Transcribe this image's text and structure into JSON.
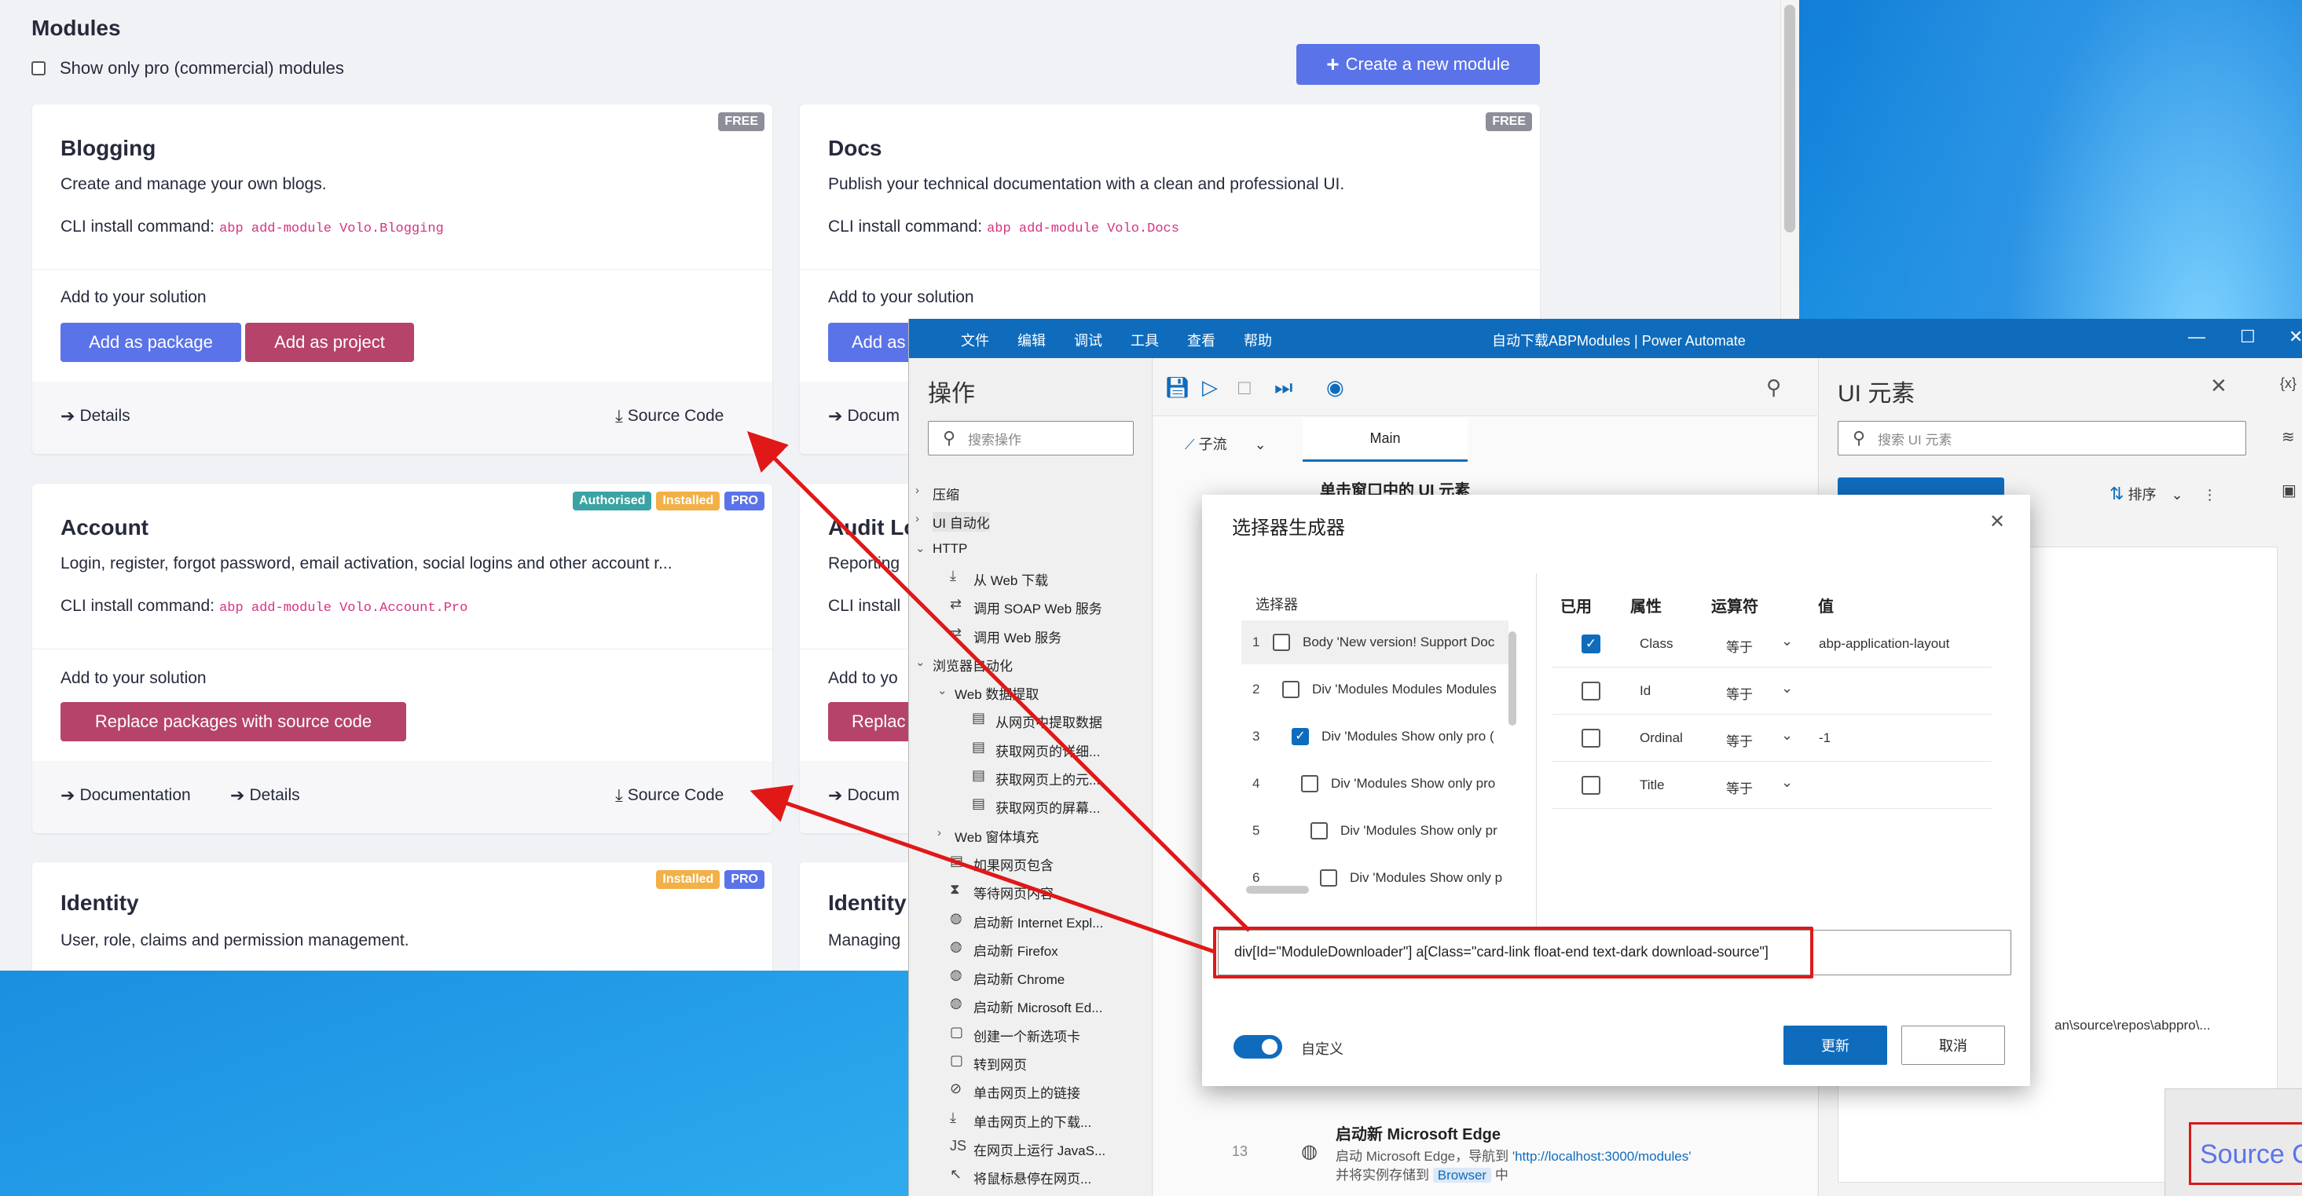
{
  "browser": {
    "page_title": "Modules",
    "pro_filter_label": "Show only pro (commercial) modules",
    "create_button": "Create a new module",
    "cards": [
      {
        "title": "Blogging",
        "badges": [
          "FREE"
        ],
        "description": "Create and manage your own blogs.",
        "cli_label": "CLI install command:",
        "cli_cmd": "abp add-module Volo.Blogging",
        "add_label": "Add to your solution",
        "btn_package": "Add as package",
        "btn_project": "Add as project",
        "details": "Details",
        "source_code": "Source Code"
      },
      {
        "title": "Docs",
        "badges": [
          "FREE"
        ],
        "description": "Publish your technical documentation with a clean and professional UI.",
        "cli_label": "CLI install command:",
        "cli_cmd": "abp add-module Volo.Docs",
        "add_label": "Add to your solution",
        "btn_package": "Add as",
        "documentation": "Docum"
      },
      {
        "title": "Account",
        "badges": [
          "Authorised",
          "Installed",
          "PRO"
        ],
        "description": "Login, register, forgot password, email activation, social logins and other account r...",
        "cli_label": "CLI install command:",
        "cli_cmd": "abp add-module Volo.Account.Pro",
        "add_label": "Add to your solution",
        "btn_replace": "Replace packages with source code",
        "documentation": "Documentation",
        "details": "Details",
        "source_code": "Source Code"
      },
      {
        "title": "Audit Lo",
        "description": "Reporting",
        "cli_label": "CLI install",
        "add_label": "Add to yo",
        "btn_replace": "Replac",
        "documentation": "Docum"
      },
      {
        "title": "Identity",
        "badges": [
          "Installed",
          "PRO"
        ],
        "description": "User, role, claims and permission management."
      },
      {
        "title": "Identity",
        "description": "Managing"
      }
    ]
  },
  "power_automate": {
    "window_title": "自动下载ABPModules | Power Automate",
    "menu": [
      "文件",
      "编辑",
      "调试",
      "工具",
      "查看",
      "帮助"
    ],
    "actions_title": "操作",
    "actions_search": "搜索操作",
    "tree": [
      {
        "label": "压缩",
        "level": 0,
        "arrow": "›"
      },
      {
        "label": "UI 自动化",
        "level": 0,
        "arrow": "›"
      },
      {
        "label": "HTTP",
        "level": 0,
        "arrow": "⌄"
      },
      {
        "label": "从 Web 下载",
        "level": 1,
        "icon": "⤓"
      },
      {
        "label": "调用 SOAP Web 服务",
        "level": 1,
        "icon": "⇄"
      },
      {
        "label": "调用 Web 服务",
        "level": 1,
        "icon": "⇄"
      },
      {
        "label": "浏览器自动化",
        "level": 0,
        "arrow": "⌄"
      },
      {
        "label": "Web 数据提取",
        "level": 1,
        "arrow": "⌄"
      },
      {
        "label": "从网页中提取数据",
        "level": 2,
        "icon": "▤"
      },
      {
        "label": "获取网页的详细...",
        "level": 2,
        "icon": "▤"
      },
      {
        "label": "获取网页上的元...",
        "level": 2,
        "icon": "▤"
      },
      {
        "label": "获取网页的屏幕...",
        "level": 2,
        "icon": "▤"
      },
      {
        "label": "Web 窗体填充",
        "level": 1,
        "arrow": "›"
      },
      {
        "label": "如果网页包含",
        "level": 1,
        "icon": "▤"
      },
      {
        "label": "等待网页内容",
        "level": 1,
        "icon": "⧗"
      },
      {
        "label": "启动新 Internet Expl...",
        "level": 1,
        "icon": "◍"
      },
      {
        "label": "启动新 Firefox",
        "level": 1,
        "icon": "◍"
      },
      {
        "label": "启动新 Chrome",
        "level": 1,
        "icon": "◍"
      },
      {
        "label": "启动新 Microsoft Ed...",
        "level": 1,
        "icon": "◍"
      },
      {
        "label": "创建一个新选项卡",
        "level": 1,
        "icon": "▢"
      },
      {
        "label": "转到网页",
        "level": 1,
        "icon": "▢"
      },
      {
        "label": "单击网页上的链接",
        "level": 1,
        "icon": "⊘"
      },
      {
        "label": "单击网页上的下载...",
        "level": 1,
        "icon": "⤓"
      },
      {
        "label": "在网页上运行 JavaS...",
        "level": 1,
        "icon": "JS"
      },
      {
        "label": "将鼠标悬停在网页...",
        "level": 1,
        "icon": "↖"
      }
    ],
    "subflow_label": "子流",
    "main_tab": "Main",
    "step_visible": {
      "num": "",
      "title": "单击窗口中的 UI 元素"
    },
    "step_13": {
      "num": "13",
      "title": "启动新 Microsoft Edge",
      "sub_prefix": "启动 Microsoft Edge，导航到 ",
      "sub_link": "'http://localhost:3000/modules'",
      "sub_prefix2": "并将实例存储到 ",
      "sub_var": "Browser",
      "sub_suffix": " 中"
    },
    "ui_title": "UI 元素",
    "ui_search": "搜索 UI 元素",
    "sort_label": "排序",
    "path_fragment": "an\\source\\repos\\abppro\\...",
    "thumb_text": "Source Code",
    "side_var_icon": "{x}"
  },
  "dialog": {
    "title": "选择器生成器",
    "selector_header": "选择器",
    "selectors": [
      {
        "num": "1",
        "checked": false,
        "text": "Body 'New version! Support Doc"
      },
      {
        "num": "2",
        "checked": false,
        "text": "Div 'Modules Modules Modules"
      },
      {
        "num": "3",
        "checked": true,
        "text": "Div 'Modules Show only pro ("
      },
      {
        "num": "4",
        "checked": false,
        "text": "Div 'Modules Show only pro"
      },
      {
        "num": "5",
        "checked": false,
        "text": "Div 'Modules Show only pr"
      },
      {
        "num": "6",
        "checked": false,
        "text": "Div 'Modules Show only p"
      }
    ],
    "col_used": "已用",
    "col_attr": "属性",
    "col_op": "运算符",
    "col_val": "值",
    "props": [
      {
        "checked": true,
        "name": "Class",
        "op": "等于",
        "value": "abp-application-layout"
      },
      {
        "checked": false,
        "name": "Id",
        "op": "等于",
        "value": ""
      },
      {
        "checked": false,
        "name": "Ordinal",
        "op": "等于",
        "value": "-1"
      },
      {
        "checked": false,
        "name": "Title",
        "op": "等于",
        "value": ""
      }
    ],
    "selector_text": "div[Id=\"ModuleDownloader\"]  a[Class=\"card-link float-end text-dark download-source\"]",
    "custom_label": "自定义",
    "update_btn": "更新",
    "cancel_btn": "取消"
  },
  "colors": {
    "primary": "#5b73e8",
    "danger": "#b6436a",
    "pa_blue": "#0f6cbd",
    "annotation_red": "#e01818"
  }
}
